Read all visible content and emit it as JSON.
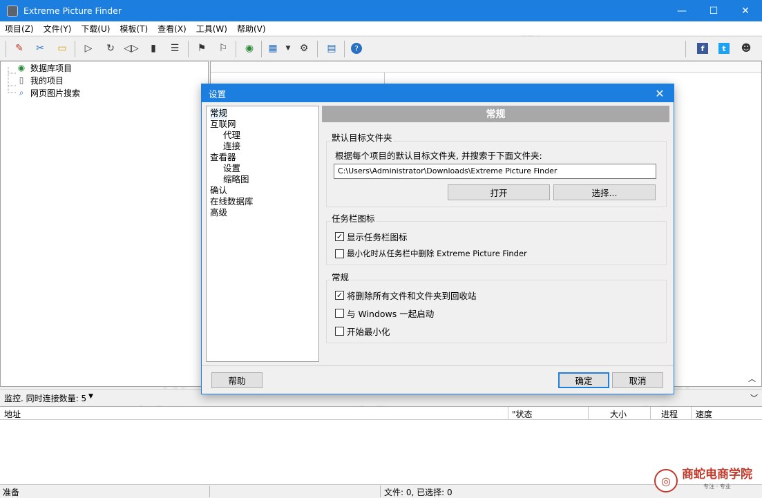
{
  "window": {
    "title": "Extreme Picture Finder",
    "minimize_glyph": "—",
    "maximize_glyph": "☐",
    "close_glyph": "✕"
  },
  "menu": [
    "项目(Z)",
    "文件(Y)",
    "下载(U)",
    "模板(T)",
    "查看(X)",
    "工具(W)",
    "帮助(V)"
  ],
  "toolbar_icons": [
    "pencil-icon",
    "tools-icon",
    "comment-icon",
    "play-icon",
    "refresh-icon",
    "play-pause-icon",
    "stop-icon",
    "queue-icon",
    "flag-icon",
    "flag-alt-icon",
    "globe-icon",
    "grid-icon",
    "dropdown-icon",
    "gear-icon",
    "list-icon",
    "help-icon",
    "facebook-icon",
    "twitter-icon",
    "users-icon"
  ],
  "tree": {
    "items": [
      "数据库项目",
      "我的项目",
      "网页图片搜索"
    ]
  },
  "monitor": {
    "label": "监控. 同时连接数量: 5"
  },
  "grid": {
    "columns": [
      "地址",
      "\"状态",
      "大小",
      "进程",
      "速度"
    ]
  },
  "status": {
    "left": "准备",
    "middle": "文件: 0, 已选择: 0"
  },
  "dialog": {
    "title": "设置",
    "nav": [
      "常规",
      "互联网",
      "代理",
      "连接",
      "查看器",
      "设置",
      "缩略图",
      "确认",
      "在线数据库",
      "高级"
    ],
    "header": "常规",
    "group1": {
      "label": "默认目标文件夹",
      "desc": "根据每个项目的默认目标文件夹, 并搜索于下面文件夹:",
      "path": "C:\\Users\\Administrator\\Downloads\\Extreme Picture Finder",
      "open_btn": "打开",
      "choose_btn": "选择..."
    },
    "group2": {
      "label": "任务栏图标",
      "opt1": "显示任务栏图标",
      "opt1_checked": true,
      "opt2": "最小化时从任务栏中删除 Extreme Picture Finder",
      "opt2_checked": false
    },
    "group3": {
      "label": "常规",
      "opt1": "将删除所有文件和文件夹到回收站",
      "opt1_checked": true,
      "opt2": "与 Windows 一起启动",
      "opt2_checked": false,
      "opt3": "开始最小化",
      "opt3_checked": false
    },
    "help_btn": "帮助",
    "ok_btn": "确定",
    "cancel_btn": "取消"
  },
  "watermark": "WEIDOWN.COM",
  "logo": {
    "text": "商蛇电商学院",
    "sub": "专注 · 专业"
  }
}
